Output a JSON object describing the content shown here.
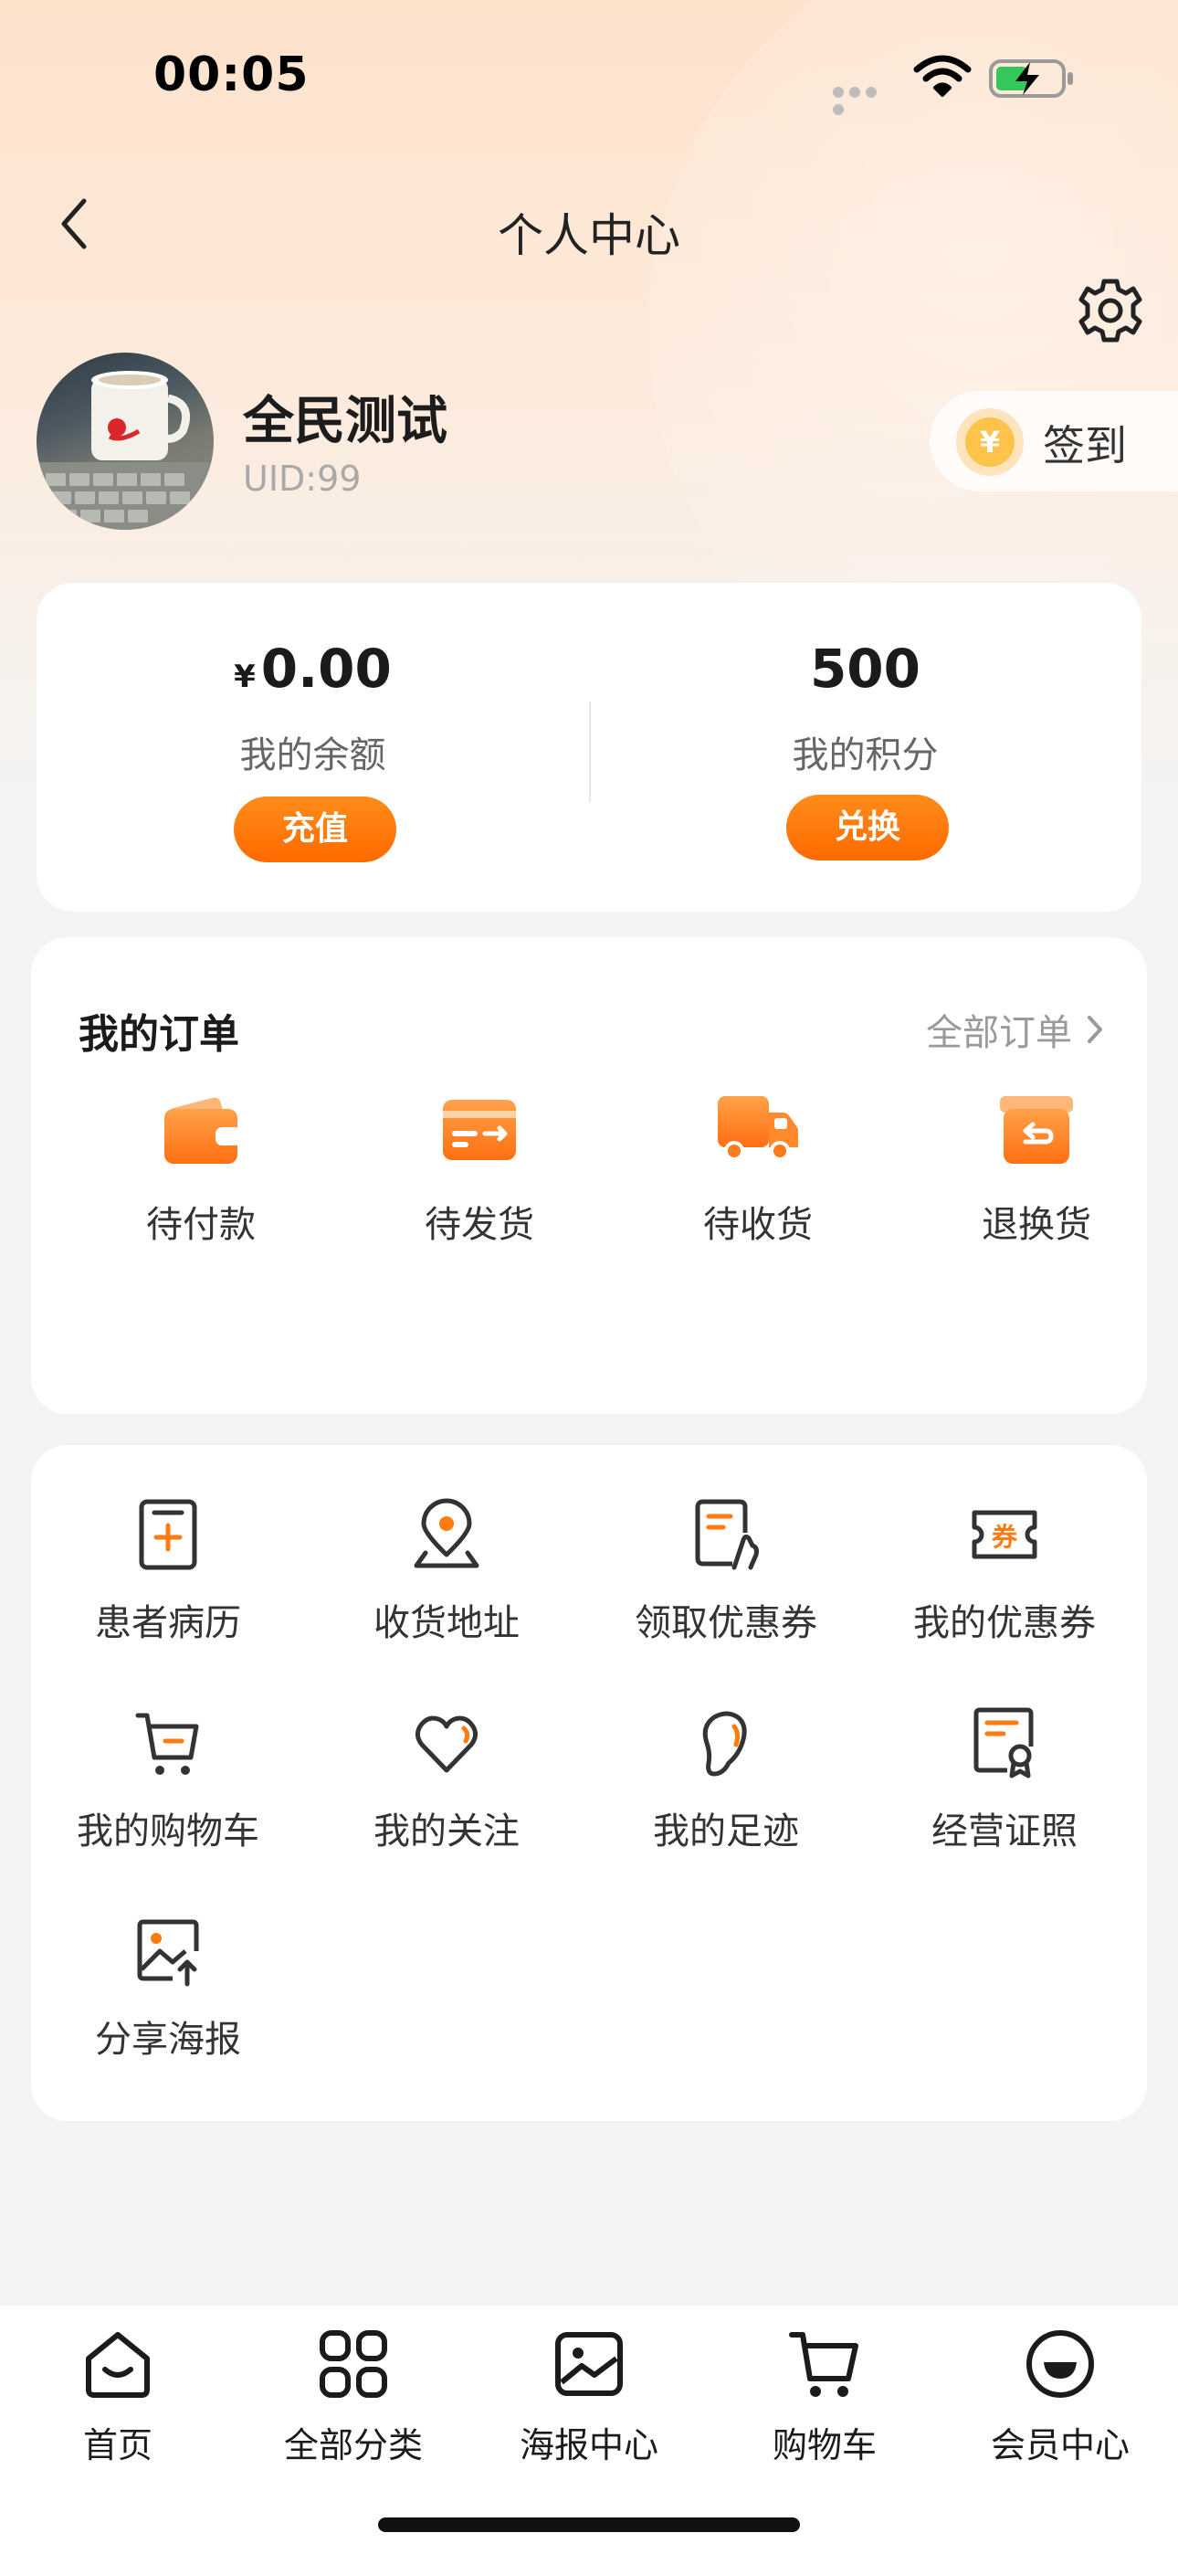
{
  "status_bar": {
    "time": "00:05"
  },
  "header": {
    "title": "个人中心"
  },
  "profile": {
    "name": "全民测试",
    "uid": "UID:99"
  },
  "signin": {
    "label": "签到",
    "coin_symbol": "¥"
  },
  "wallet": {
    "balance": {
      "currency": "¥",
      "value": "0.00",
      "label": "我的余额",
      "button": "充值"
    },
    "points": {
      "value": "500",
      "label": "我的积分",
      "button": "兑换"
    }
  },
  "orders": {
    "title": "我的订单",
    "all_label": "全部订单",
    "items": [
      {
        "label": "待付款",
        "icon": "wallet-icon"
      },
      {
        "label": "待发货",
        "icon": "card-send-icon"
      },
      {
        "label": "待收货",
        "icon": "truck-icon"
      },
      {
        "label": "退换货",
        "icon": "return-box-icon"
      }
    ]
  },
  "services": {
    "items": [
      {
        "label": "患者病历",
        "icon": "medical-record-icon"
      },
      {
        "label": "收货地址",
        "icon": "location-pin-icon"
      },
      {
        "label": "领取优惠券",
        "icon": "coupon-claim-icon"
      },
      {
        "label": "我的优惠券",
        "icon": "coupon-ticket-icon",
        "glyph": "券"
      },
      {
        "label": "我的购物车",
        "icon": "shopping-cart-icon"
      },
      {
        "label": "我的关注",
        "icon": "heart-icon"
      },
      {
        "label": "我的足迹",
        "icon": "footprint-icon"
      },
      {
        "label": "经营证照",
        "icon": "certificate-icon"
      },
      {
        "label": "分享海报",
        "icon": "share-poster-icon"
      }
    ]
  },
  "tabbar": {
    "items": [
      {
        "label": "首页",
        "icon": "home-icon"
      },
      {
        "label": "全部分类",
        "icon": "grid-icon"
      },
      {
        "label": "海报中心",
        "icon": "image-icon"
      },
      {
        "label": "购物车",
        "icon": "cart-icon"
      },
      {
        "label": "会员中心",
        "icon": "member-smile-icon"
      }
    ]
  },
  "colors": {
    "accent": "#ff7a0f",
    "accent_light": "#ffb066",
    "icon_dark": "#333333"
  }
}
